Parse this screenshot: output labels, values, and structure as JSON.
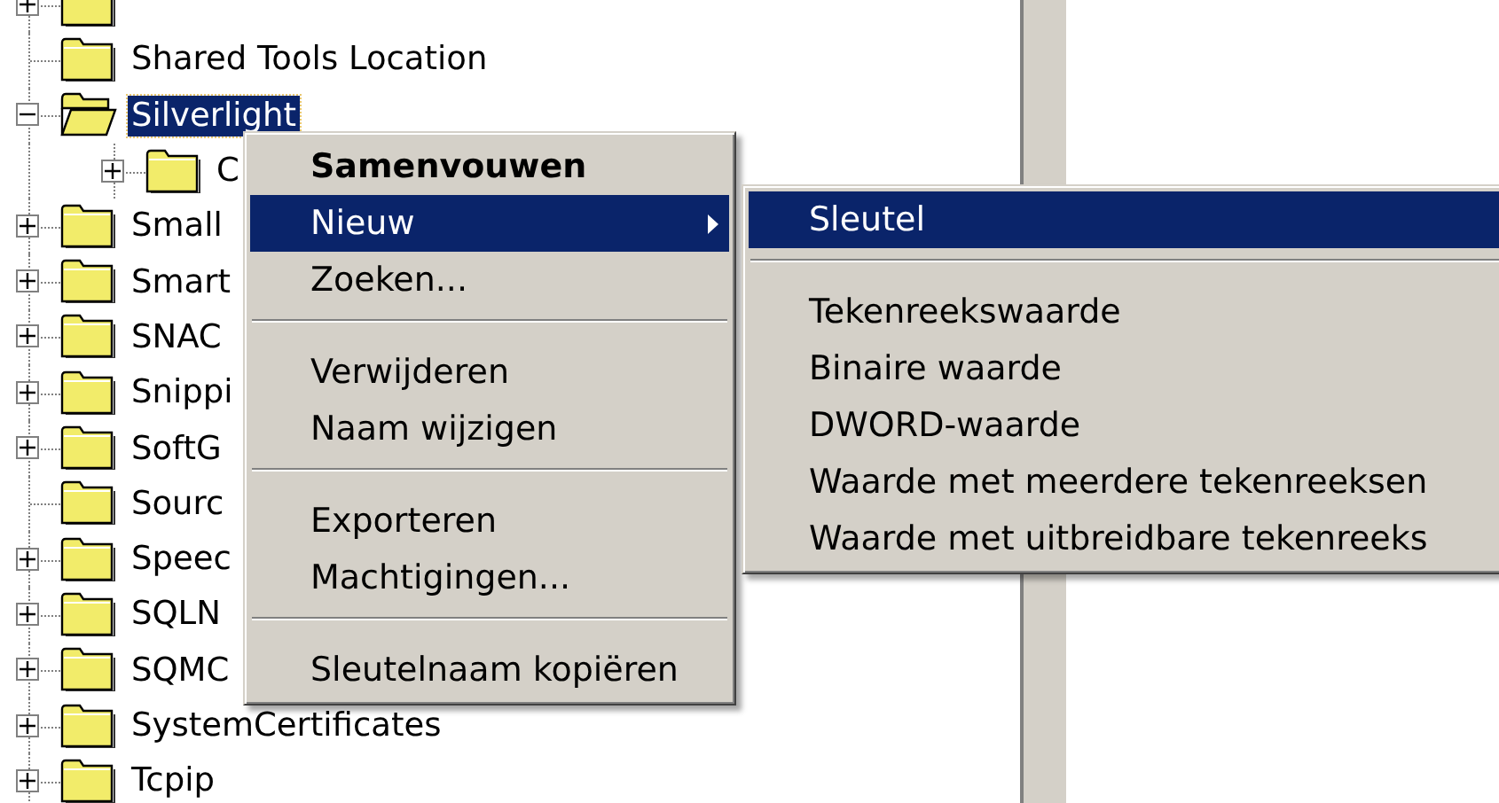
{
  "tree": [
    {
      "expanded": false,
      "selected": false
    },
    {
      "label": "Shared Tools Location",
      "selected": false
    },
    {
      "label": "Silverlight",
      "expanded": true,
      "selected": true,
      "children": [
        {
          "label": "C",
          "expanded": false,
          "selected": false
        }
      ]
    },
    {
      "label": "Small",
      "expanded": false,
      "selected": false
    },
    {
      "label": "Smart",
      "expanded": false,
      "selected": false
    },
    {
      "label": "SNAC",
      "expanded": false,
      "selected": false
    },
    {
      "label": "Snippi",
      "expanded": false,
      "selected": false
    },
    {
      "label": "SoftG",
      "expanded": false,
      "selected": false
    },
    {
      "label": "Sourc",
      "selected": false
    },
    {
      "label": "Speec",
      "expanded": false,
      "selected": false
    },
    {
      "label": "SQLN",
      "expanded": false,
      "selected": false
    },
    {
      "label": "SQMC",
      "expanded": false,
      "selected": false
    },
    {
      "label": "SystemCertificates",
      "expanded": false,
      "selected": false
    },
    {
      "label": "Tcpip",
      "expanded": false,
      "selected": false
    }
  ],
  "context_menu": [
    {
      "kind": "item",
      "label": "Samenvouwen",
      "bold": true,
      "selected": false,
      "submenu": false
    },
    {
      "kind": "item",
      "label": "Nieuw",
      "bold": false,
      "selected": true,
      "submenu": true
    },
    {
      "kind": "item",
      "label": "Zoeken...",
      "bold": false,
      "selected": false,
      "submenu": false
    },
    {
      "kind": "separator"
    },
    {
      "kind": "item",
      "label": "Verwijderen",
      "bold": false,
      "selected": false,
      "submenu": false
    },
    {
      "kind": "item",
      "label": "Naam wijzigen",
      "bold": false,
      "selected": false,
      "submenu": false
    },
    {
      "kind": "separator"
    },
    {
      "kind": "item",
      "label": "Exporteren",
      "bold": false,
      "selected": false,
      "submenu": false
    },
    {
      "kind": "item",
      "label": "Machtigingen...",
      "bold": false,
      "selected": false,
      "submenu": false
    },
    {
      "kind": "separator"
    },
    {
      "kind": "item",
      "label": "Sleutelnaam kopiëren",
      "bold": false,
      "selected": false,
      "submenu": false
    }
  ],
  "submenu": [
    {
      "kind": "item",
      "label": "Sleutel",
      "bold": false,
      "selected": true,
      "submenu": false
    },
    {
      "kind": "separator"
    },
    {
      "kind": "item",
      "label": "Tekenreekswaarde",
      "bold": false,
      "selected": false,
      "submenu": false
    },
    {
      "kind": "item",
      "label": "Binaire waarde",
      "bold": false,
      "selected": false,
      "submenu": false
    },
    {
      "kind": "item",
      "label": "DWORD-waarde",
      "bold": false,
      "selected": false,
      "submenu": false
    },
    {
      "kind": "item",
      "label": "Waarde met meerdere tekenreeksen",
      "bold": false,
      "selected": false,
      "submenu": false
    },
    {
      "kind": "item",
      "label": "Waarde met uitbreidbare tekenreeks",
      "bold": false,
      "selected": false,
      "submenu": false
    }
  ]
}
